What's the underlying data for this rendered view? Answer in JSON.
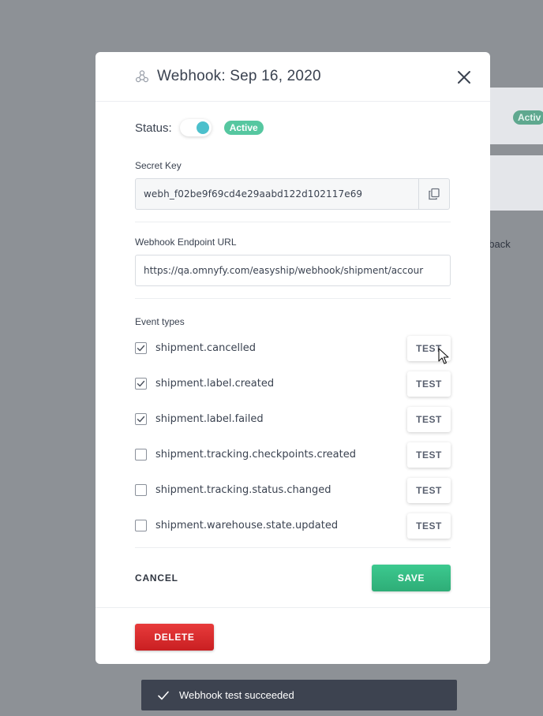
{
  "background": {
    "badge": "Activ",
    "text": "dback"
  },
  "modal": {
    "title": "Webhook: Sep 16, 2020",
    "status_label": "Status:",
    "status_badge": "Active",
    "secret": {
      "label": "Secret Key",
      "value": "webh_f02be9f69cd4e29aabd122d102117e69"
    },
    "endpoint": {
      "label": "Webhook Endpoint URL",
      "value": "https://qa.omnyfy.com/easyship/webhook/shipment/accour"
    },
    "events": {
      "label": "Event types",
      "items": [
        {
          "name": "shipment.cancelled",
          "checked": true,
          "test_label": "TEST"
        },
        {
          "name": "shipment.label.created",
          "checked": true,
          "test_label": "TEST"
        },
        {
          "name": "shipment.label.failed",
          "checked": true,
          "test_label": "TEST"
        },
        {
          "name": "shipment.tracking.checkpoints.created",
          "checked": false,
          "test_label": "TEST"
        },
        {
          "name": "shipment.tracking.status.changed",
          "checked": false,
          "test_label": "TEST"
        },
        {
          "name": "shipment.warehouse.state.updated",
          "checked": false,
          "test_label": "TEST"
        }
      ]
    },
    "cancel_label": "CANCEL",
    "save_label": "SAVE",
    "delete_label": "DELETE"
  },
  "toast": {
    "text": "Webhook test succeeded"
  },
  "colors": {
    "accent": "#4cc0cc",
    "success": "#56c7a0",
    "save": "#2ead77",
    "danger": "#d42a2c",
    "toast_bg": "#3d4350"
  }
}
